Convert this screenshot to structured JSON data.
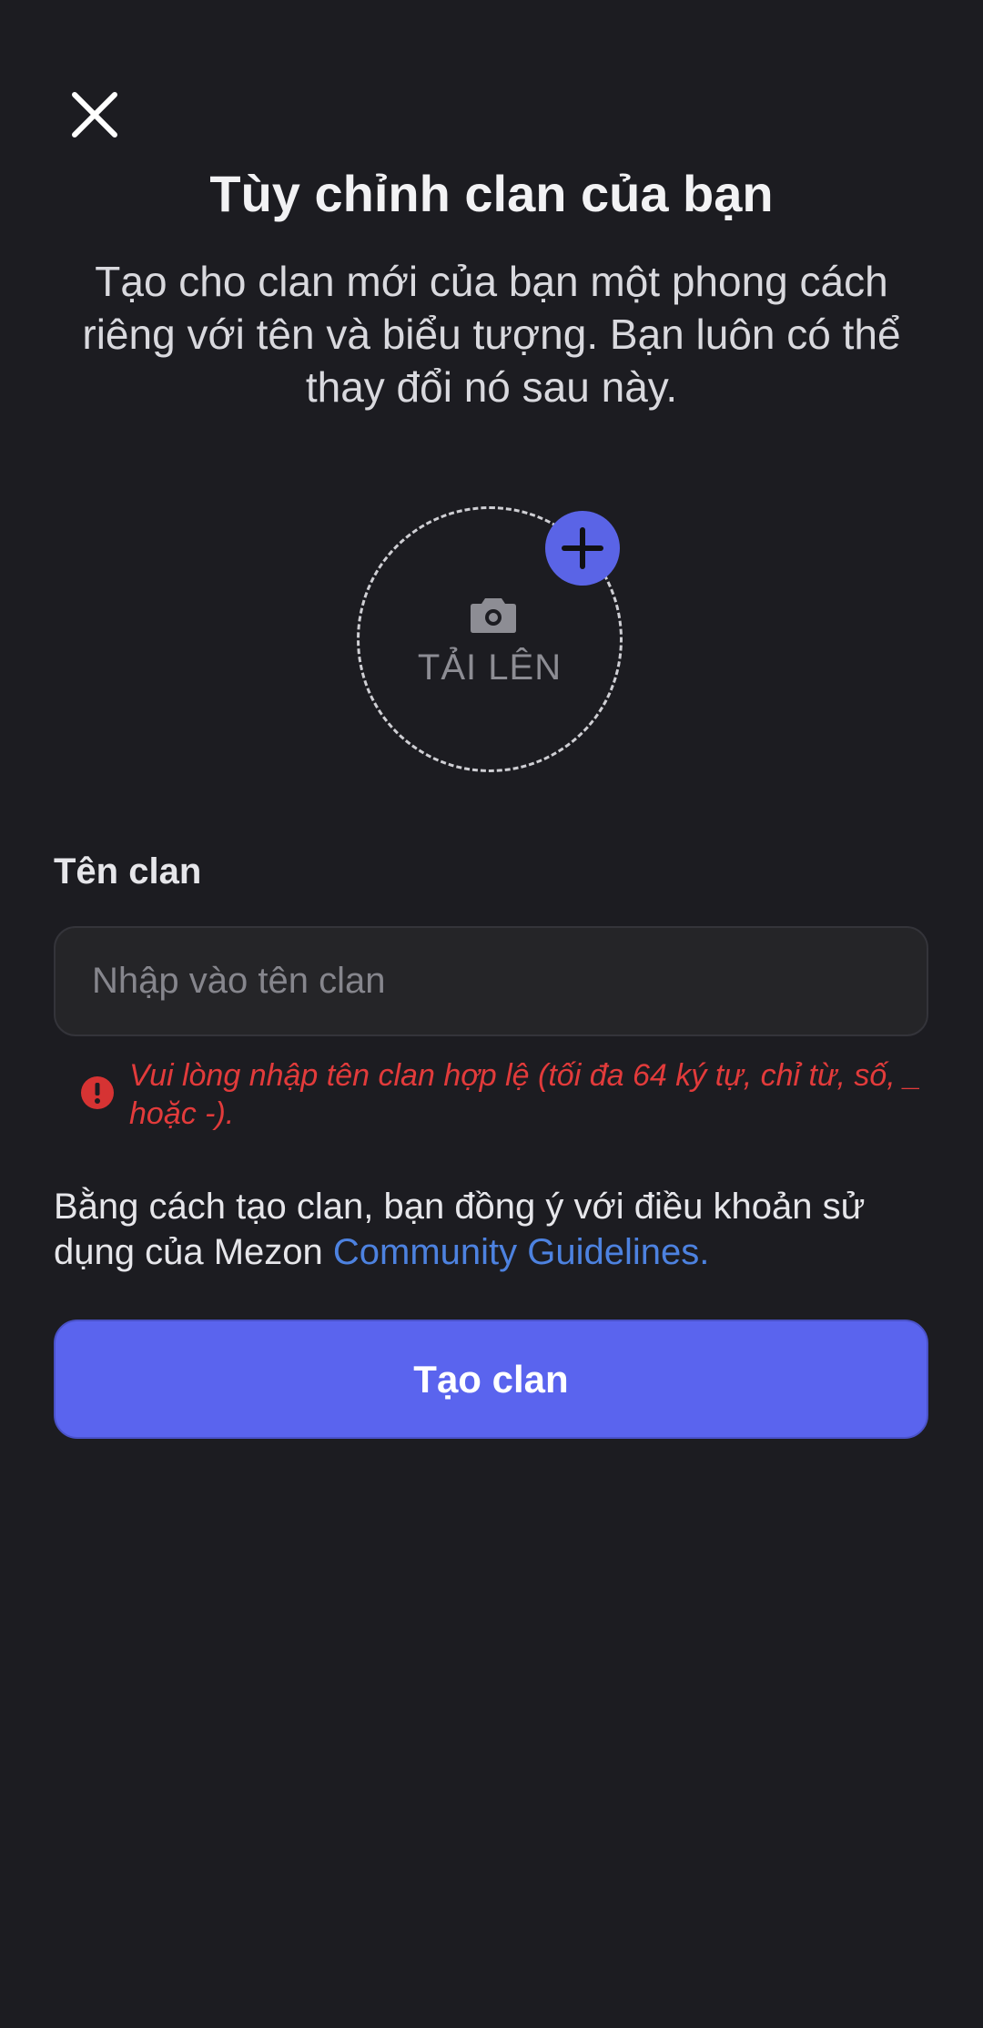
{
  "header": {
    "close_icon": "close-icon",
    "title": "Tùy chỉnh clan của bạn",
    "subtitle": "Tạo cho clan mới của bạn một phong cách riêng với tên và biểu tượng. Bạn luôn có thể thay đổi nó sau này."
  },
  "upload": {
    "icon": "camera-icon",
    "label": "TẢI LÊN",
    "badge_icon": "plus-icon"
  },
  "form": {
    "field_label": "Tên clan",
    "input_value": "",
    "input_placeholder": "Nhập vào tên clan",
    "error_icon": "error-circle-icon",
    "error_text": "Vui lòng nhập tên clan hợp lệ (tối đa 64 ký tự, chỉ từ, số, _ hoặc -)."
  },
  "terms": {
    "text": "Bằng cách tạo clan, bạn đồng ý với điều khoản sử dụng của Mezon ",
    "link_text": "Community Guidelines."
  },
  "actions": {
    "create_label": "Tạo clan"
  },
  "colors": {
    "background": "#1c1c21",
    "accent": "#5a64ee",
    "link": "#4d82e0",
    "error": "#e23b3b"
  }
}
